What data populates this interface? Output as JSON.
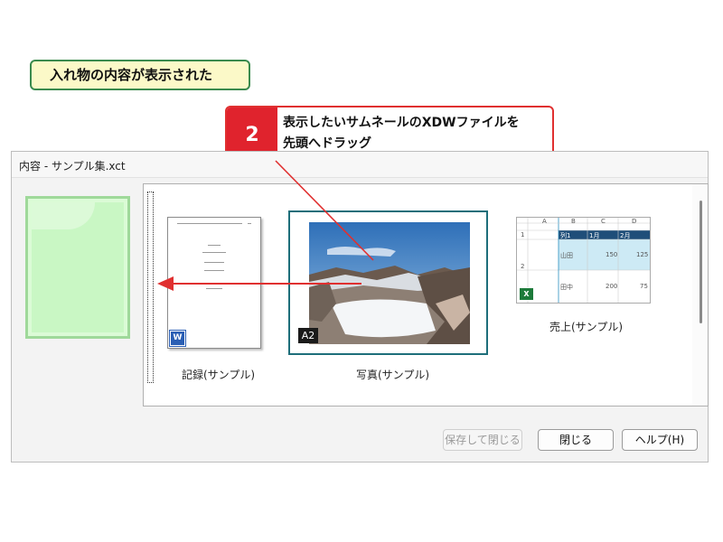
{
  "status_callout": "入れ物の内容が表示された",
  "step": {
    "number": "2",
    "text_line1": "表示したいサムネールのXDWファイルを",
    "text_line2": "先頭へドラッグ"
  },
  "window": {
    "title": "内容 - サンプル集.xct"
  },
  "documents": [
    {
      "caption": "記録(サンプル)",
      "icon": "word-file-icon"
    },
    {
      "caption": "写真(サンプル)",
      "badge": "A2"
    },
    {
      "caption": "売上(サンプル)",
      "icon": "excel-file-icon"
    }
  ],
  "sheet": {
    "col_letters": [
      "A",
      "B",
      "C",
      "D"
    ],
    "header": [
      "列1",
      "1月",
      "2月"
    ],
    "rows": [
      {
        "num": "1",
        "name": "",
        "v1": "",
        "v2": ""
      },
      {
        "num": "2",
        "name": "山田",
        "v1": "150",
        "v2": "125"
      },
      {
        "num": "",
        "name": "田中",
        "v1": "200",
        "v2": "75"
      }
    ]
  },
  "buttons": {
    "save_close": "保存して閉じる",
    "close": "閉じる",
    "help": "ヘルプ(H)"
  },
  "colors": {
    "callout_green_border": "#3a8a4e",
    "callout_yellow_bg": "#fbf9c8",
    "step_red": "#e0232d",
    "selection_teal": "#1e6e7a",
    "drag_arrow_red": "#e03030"
  }
}
